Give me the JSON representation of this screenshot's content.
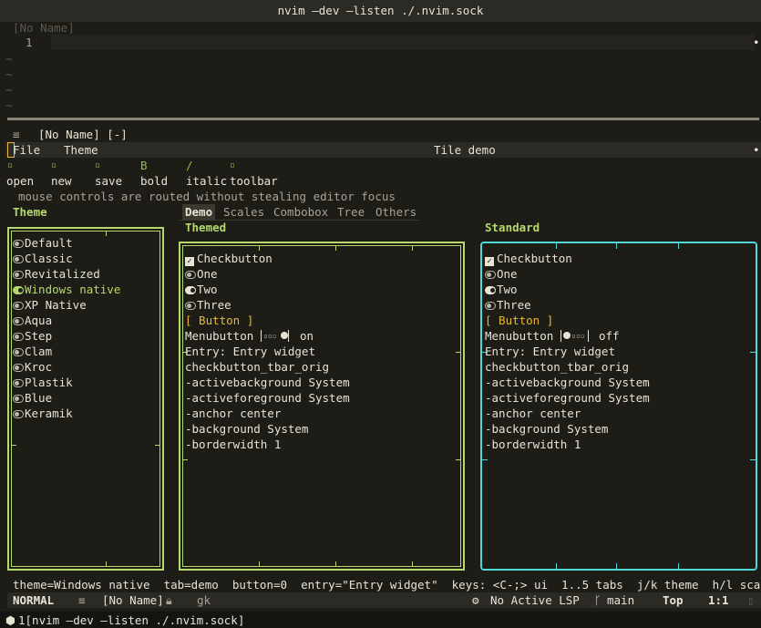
{
  "window": {
    "title": "nvim —dev —listen ./.nvim.sock"
  },
  "editor": {
    "top_buffer_name": "[No Name]",
    "line_number": "1",
    "tilde": "~",
    "lower_buffer_title": "[No Name] [-]"
  },
  "menubar": {
    "file": "File",
    "theme": "Theme",
    "title": "Tile demo"
  },
  "toolbar": {
    "items": [
      {
        "icon": "open-icon",
        "glyph": "▫",
        "label": "open"
      },
      {
        "icon": "new-icon",
        "glyph": "▫",
        "label": "new"
      },
      {
        "icon": "save-icon",
        "glyph": "▫",
        "label": "save"
      },
      {
        "icon": "bold-icon",
        "glyph": "B",
        "label": "bold"
      },
      {
        "icon": "italic-icon",
        "glyph": "/",
        "label": "italic"
      },
      {
        "icon": "toolbar-icon",
        "glyph": "▫",
        "label": "toolbar"
      }
    ],
    "hint": "mouse controls are routed without stealing editor focus"
  },
  "theme_panel": {
    "heading": "Theme",
    "selected": "Windows native",
    "items": [
      "Default",
      "Classic",
      "Revitalized",
      "Windows native",
      "XP Native",
      "Aqua",
      "Step",
      "Clam",
      "Kroc",
      "Plastik",
      "Blue",
      "Keramik"
    ]
  },
  "tabs": [
    "Demo",
    "Scales",
    "Combobox",
    "Tree",
    "Others"
  ],
  "active_tab": "Demo",
  "themed": {
    "heading": "Themed",
    "checkbutton": "Checkbutton",
    "radios": [
      "One",
      "Two",
      "Three"
    ],
    "selected_radio": "Two",
    "button": "[ Button ]",
    "menubutton_label": "Menubutton",
    "menubutton_state": "on",
    "entry": "Entry: Entry widget",
    "props": [
      "checkbutton_tbar_orig",
      "-activebackground System",
      "-activeforeground System",
      "-anchor center",
      "-background System",
      "-borderwidth 1"
    ]
  },
  "standard": {
    "heading": "Standard",
    "checkbutton": "Checkbutton",
    "radios": [
      "One",
      "Two",
      "Three"
    ],
    "selected_radio": "Two",
    "button": "[ Button ]",
    "menubutton_label": "Menubutton",
    "menubutton_state": "off",
    "entry": "Entry: Entry widget",
    "props": [
      "checkbutton_tbar_orig",
      "-activebackground System",
      "-activeforeground System",
      "-anchor center",
      "-background System",
      "-borderwidth 1"
    ]
  },
  "status_text": "theme=Windows native  tab=demo  button=0  entry=\"Entry widget\"  keys: <C-;> ui  1..5 tabs  j/k theme  h/l scale  q qu",
  "statusline": {
    "mode": "NORMAL",
    "buffer": "[No Name]",
    "extra": "gk",
    "lsp": "No Active LSP",
    "branch": "main",
    "position": "Top",
    "cursor": "1:1"
  },
  "bottom_tab": "1[nvim —dev —listen ./.nvim.sock]",
  "colors": {
    "accent": "#b5d96b",
    "standard_border": "#4fd8d8",
    "button": "#e8b93a"
  }
}
